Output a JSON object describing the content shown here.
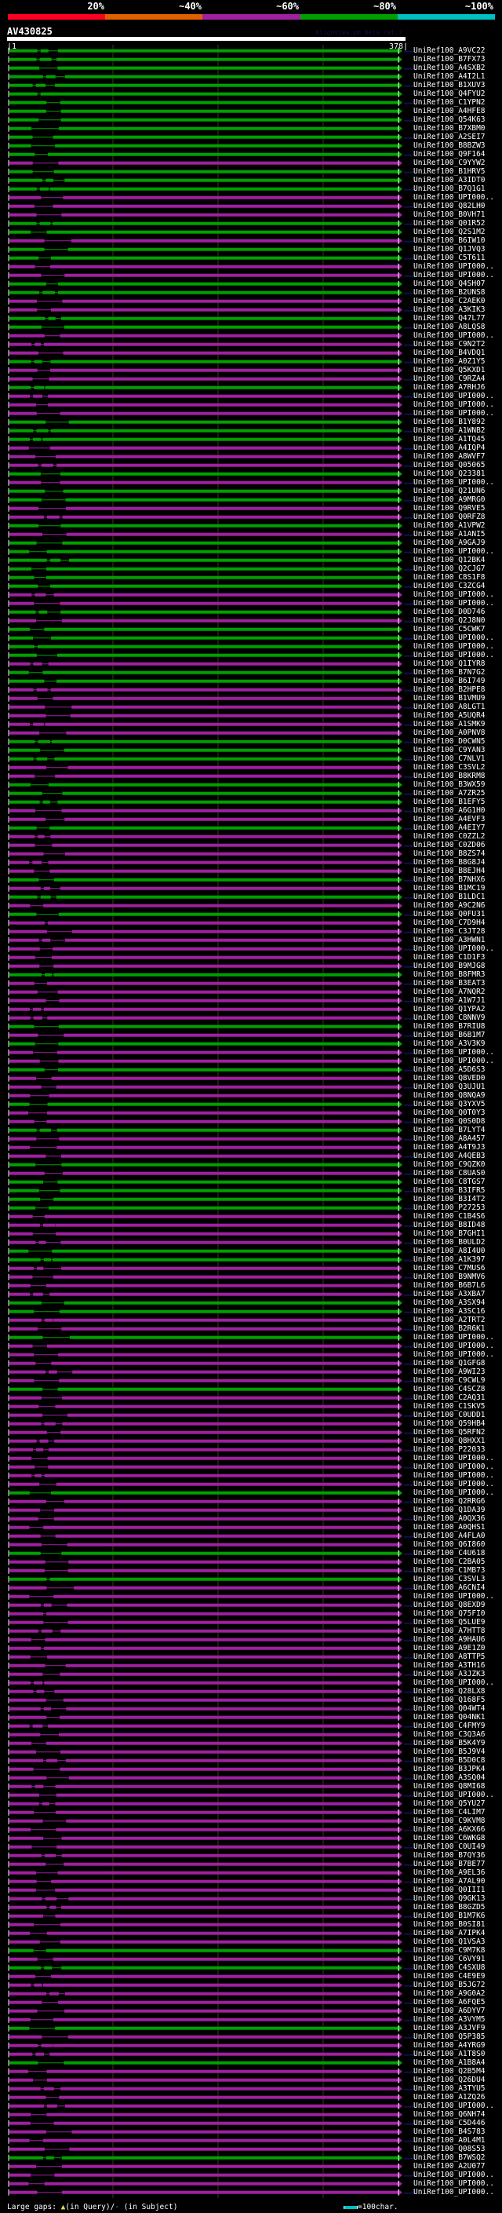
{
  "header": {
    "percent_labels": [
      "20%",
      "~40%",
      "~60%",
      "~80%",
      "~100%"
    ],
    "color_scale": [
      "#ff0020",
      "#e06000",
      "#a020a0",
      "#00a000",
      "#00c0c0"
    ],
    "query_name": "AV430825",
    "brand": "AlignView.pm Beta rel.7",
    "start": "|1",
    "end": "378|"
  },
  "colors": {
    "g": "#00a000",
    "m": "#a020a0",
    "guide": "#3a3a10",
    "connector": "#10104a"
  },
  "query_length": 378,
  "rows": [
    [
      "UniRef100_A9VC22",
      "g"
    ],
    [
      "UniRef100_B7FX73",
      "g"
    ],
    [
      "UniRef100_A4SXB2",
      "g"
    ],
    [
      "UniRef100_A4I2L1",
      "g"
    ],
    [
      "UniRef100_B1XUV3",
      "g"
    ],
    [
      "UniRef100_Q4FYU2",
      "g"
    ],
    [
      "UniRef100_C1YPN2",
      "g"
    ],
    [
      "UniRef100_A4HFE8",
      "g"
    ],
    [
      "UniRef100_Q54K63",
      "g"
    ],
    [
      "UniRef100_B7XBM0",
      "g"
    ],
    [
      "UniRef100_A2SEI7",
      "g"
    ],
    [
      "UniRef100_B8BZW3",
      "g"
    ],
    [
      "UniRef100_Q9F164",
      "g"
    ],
    [
      "UniRef100_C9YYW2",
      "m"
    ],
    [
      "UniRef100_B1HRV5",
      "g"
    ],
    [
      "UniRef100_A3IDT0",
      "g"
    ],
    [
      "UniRef100_B7Q1G1",
      "g"
    ],
    [
      "UniRef100_UPI000..",
      "m"
    ],
    [
      "UniRef100_Q82LH0",
      "m"
    ],
    [
      "UniRef100_B0VH71",
      "m"
    ],
    [
      "UniRef100_Q01R52",
      "g"
    ],
    [
      "UniRef100_Q2S1M2",
      "g"
    ],
    [
      "UniRef100_B6IW10",
      "m"
    ],
    [
      "UniRef100_Q1JVQ3",
      "g"
    ],
    [
      "UniRef100_C5T611",
      "g"
    ],
    [
      "UniRef100_UPI000..",
      "m"
    ],
    [
      "UniRef100_UPI000..",
      "m"
    ],
    [
      "UniRef100_Q4SH07",
      "g"
    ],
    [
      "UniRef100_B2UNS8",
      "g"
    ],
    [
      "UniRef100_C2AEK0",
      "m"
    ],
    [
      "UniRef100_A3KIK3",
      "m"
    ],
    [
      "UniRef100_Q47L77",
      "g"
    ],
    [
      "UniRef100_A8LQS8",
      "g"
    ],
    [
      "UniRef100_UPI000..",
      "m"
    ],
    [
      "UniRef100_C9N2T2",
      "m"
    ],
    [
      "UniRef100_B4VDQ1",
      "m"
    ],
    [
      "UniRef100_A0Z1Y5",
      "g"
    ],
    [
      "UniRef100_Q5KXD1",
      "m"
    ],
    [
      "UniRef100_C9RZA4",
      "m"
    ],
    [
      "UniRef100_A7RHJ6",
      "g"
    ],
    [
      "UniRef100_UPI000..",
      "m"
    ],
    [
      "UniRef100_UPI000..",
      "m"
    ],
    [
      "UniRef100_UPI000..",
      "m"
    ],
    [
      "UniRef100_B1Y892",
      "g"
    ],
    [
      "UniRef100_A1WNB2",
      "g"
    ],
    [
      "UniRef100_A1TQ45",
      "g"
    ],
    [
      "UniRef100_A4IQP4",
      "m"
    ],
    [
      "UniRef100_A8WVF7",
      "m"
    ],
    [
      "UniRef100_Q05065",
      "m"
    ],
    [
      "UniRef100_Q23381",
      "g"
    ],
    [
      "UniRef100_UPI000..",
      "m"
    ],
    [
      "UniRef100_Q21UN6",
      "g"
    ],
    [
      "UniRef100_A9MRG0",
      "g"
    ],
    [
      "UniRef100_Q9RVE5",
      "m"
    ],
    [
      "UniRef100_Q0RFZ8",
      "m"
    ],
    [
      "UniRef100_A1VPW2",
      "g"
    ],
    [
      "UniRef100_A1ANI5",
      "m"
    ],
    [
      "UniRef100_A9GAJ9",
      "g"
    ],
    [
      "UniRef100_UPI000..",
      "g"
    ],
    [
      "UniRef100_Q12BK4",
      "g"
    ],
    [
      "UniRef100_Q2CJG7",
      "g"
    ],
    [
      "UniRef100_C8S1F8",
      "g"
    ],
    [
      "UniRef100_C3ZCG4",
      "g"
    ],
    [
      "UniRef100_UPI000..",
      "m"
    ],
    [
      "UniRef100_UPI000..",
      "m"
    ],
    [
      "UniRef100_D0D746",
      "g"
    ],
    [
      "UniRef100_Q2J8N0",
      "m"
    ],
    [
      "UniRef100_C5CWK7",
      "g"
    ],
    [
      "UniRef100_UPI000..",
      "g"
    ],
    [
      "UniRef100_UPI000..",
      "g"
    ],
    [
      "UniRef100_UPI000..",
      "g"
    ],
    [
      "UniRef100_Q1IYR8",
      "m"
    ],
    [
      "UniRef100_B7N7G2",
      "g"
    ],
    [
      "UniRef100_B6I749",
      "g"
    ],
    [
      "UniRef100_B2HPE8",
      "m"
    ],
    [
      "UniRef100_B1VMU9",
      "m"
    ],
    [
      "UniRef100_A8LGT1",
      "m"
    ],
    [
      "UniRef100_A5UQR4",
      "m"
    ],
    [
      "UniRef100_A1SMK9",
      "m"
    ],
    [
      "UniRef100_A0PNV8",
      "m"
    ],
    [
      "UniRef100_D0CWN5",
      "g"
    ],
    [
      "UniRef100_C9YAN3",
      "g"
    ],
    [
      "UniRef100_C7NLV1",
      "g"
    ],
    [
      "UniRef100_C3SVL2",
      "m"
    ],
    [
      "UniRef100_B8KRM8",
      "m"
    ],
    [
      "UniRef100_B3WX59",
      "g"
    ],
    [
      "UniRef100_A7ZR25",
      "g"
    ],
    [
      "UniRef100_B1EFY5",
      "g"
    ],
    [
      "UniRef100_A6G1H0",
      "m"
    ],
    [
      "UniRef100_A4EVF3",
      "m"
    ],
    [
      "UniRef100_A4EIY7",
      "g"
    ],
    [
      "UniRef100_C0ZZL2",
      "m"
    ],
    [
      "UniRef100_C0ZD06",
      "m"
    ],
    [
      "UniRef100_B8ZS74",
      "m"
    ],
    [
      "UniRef100_B8G8J4",
      "m"
    ],
    [
      "UniRef100_B8EJH4",
      "m"
    ],
    [
      "UniRef100_B7NHX6",
      "g"
    ],
    [
      "UniRef100_B1MC19",
      "m"
    ],
    [
      "UniRef100_B1LDC1",
      "g"
    ],
    [
      "UniRef100_A9C2N6",
      "m"
    ],
    [
      "UniRef100_Q0FU31",
      "g"
    ],
    [
      "UniRef100_C7D9H4",
      "m"
    ],
    [
      "UniRef100_C3JT28",
      "m"
    ],
    [
      "UniRef100_A3HWN1",
      "m"
    ],
    [
      "UniRef100_UPI000..",
      "m"
    ],
    [
      "UniRef100_C1D1F3",
      "m"
    ],
    [
      "UniRef100_B9MJG8",
      "m"
    ],
    [
      "UniRef100_B8FMR3",
      "g"
    ],
    [
      "UniRef100_B3EAT3",
      "m"
    ],
    [
      "UniRef100_A7NQR2",
      "m"
    ],
    [
      "UniRef100_A1W7J1",
      "m"
    ],
    [
      "UniRef100_Q1YPA2",
      "m"
    ],
    [
      "UniRef100_C8NNV9",
      "m"
    ],
    [
      "UniRef100_B7RIU8",
      "g"
    ],
    [
      "UniRef100_B6B1M7",
      "m"
    ],
    [
      "UniRef100_A3V3K9",
      "g"
    ],
    [
      "UniRef100_UPI000..",
      "m"
    ],
    [
      "UniRef100_UPI000..",
      "m"
    ],
    [
      "UniRef100_A5D6S3",
      "g"
    ],
    [
      "UniRef100_Q8VED0",
      "m"
    ],
    [
      "UniRef100_Q3UJU1",
      "m"
    ],
    [
      "UniRef100_Q8NQA9",
      "m"
    ],
    [
      "UniRef100_Q3YXV5",
      "g"
    ],
    [
      "UniRef100_Q0T0Y3",
      "m"
    ],
    [
      "UniRef100_Q0S0D8",
      "m"
    ],
    [
      "UniRef100_B7LYT4",
      "g"
    ],
    [
      "UniRef100_A8A457",
      "m"
    ],
    [
      "UniRef100_A4T9J3",
      "m"
    ],
    [
      "UniRef100_A4QEB3",
      "m"
    ],
    [
      "UniRef100_C9QZK0",
      "g"
    ],
    [
      "UniRef100_C8UAS0",
      "m"
    ],
    [
      "UniRef100_C8TGS7",
      "g"
    ],
    [
      "UniRef100_B3IFR5",
      "g"
    ],
    [
      "UniRef100_B3I4T2",
      "g"
    ],
    [
      "UniRef100_P27253",
      "g"
    ],
    [
      "UniRef100_C1B4S6",
      "m"
    ],
    [
      "UniRef100_B8ID48",
      "m"
    ],
    [
      "UniRef100_B7GHI1",
      "m"
    ],
    [
      "UniRef100_B0ULD2",
      "m"
    ],
    [
      "UniRef100_A8I4U0",
      "g"
    ],
    [
      "UniRef100_A1K397",
      "g"
    ],
    [
      "UniRef100_C7MUS6",
      "m"
    ],
    [
      "UniRef100_B9NMV6",
      "m"
    ],
    [
      "UniRef100_B6B7L6",
      "m"
    ],
    [
      "UniRef100_A3XBA7",
      "m"
    ],
    [
      "UniRef100_A3SX94",
      "g"
    ],
    [
      "UniRef100_A3SC16",
      "g"
    ],
    [
      "UniRef100_A2TRT2",
      "m"
    ],
    [
      "UniRef100_B2R6K1",
      "m"
    ],
    [
      "UniRef100_UPI000..",
      "g"
    ],
    [
      "UniRef100_UPI000..",
      "m"
    ],
    [
      "UniRef100_UPI000..",
      "m"
    ],
    [
      "UniRef100_Q1GFG8",
      "m"
    ],
    [
      "UniRef100_A9WI23",
      "m"
    ],
    [
      "UniRef100_C9CWL9",
      "m"
    ],
    [
      "UniRef100_C4SCZ8",
      "g"
    ],
    [
      "UniRef100_C2AQ31",
      "m"
    ],
    [
      "UniRef100_C1SKV5",
      "m"
    ],
    [
      "UniRef100_C0UDD1",
      "m"
    ],
    [
      "UniRef100_Q59HB4",
      "m"
    ],
    [
      "UniRef100_Q5RFN2",
      "m"
    ],
    [
      "UniRef100_Q8HXX1",
      "m"
    ],
    [
      "UniRef100_P22033",
      "m"
    ],
    [
      "UniRef100_UPI000..",
      "m"
    ],
    [
      "UniRef100_UPI000..",
      "m"
    ],
    [
      "UniRef100_UPI000..",
      "m"
    ],
    [
      "UniRef100_UPI000..",
      "m"
    ],
    [
      "UniRef100_UPI000..",
      "g"
    ],
    [
      "UniRef100_Q2RRG6",
      "m"
    ],
    [
      "UniRef100_Q1DA39",
      "m"
    ],
    [
      "UniRef100_A0QX36",
      "m"
    ],
    [
      "UniRef100_A0QHS1",
      "m"
    ],
    [
      "UniRef100_A4FLA0",
      "m"
    ],
    [
      "UniRef100_Q6I860",
      "m"
    ],
    [
      "UniRef100_C4U618",
      "g"
    ],
    [
      "UniRef100_C2BA05",
      "m"
    ],
    [
      "UniRef100_C1MB73",
      "m"
    ],
    [
      "UniRef100_C3SVL3",
      "g"
    ],
    [
      "UniRef100_A6CNI4",
      "m"
    ],
    [
      "UniRef100_UPI000..",
      "m"
    ],
    [
      "UniRef100_Q8EXD9",
      "m"
    ],
    [
      "UniRef100_Q75FI0",
      "m"
    ],
    [
      "UniRef100_Q5LUE9",
      "m"
    ],
    [
      "UniRef100_A7HTT8",
      "m"
    ],
    [
      "UniRef100_A9HAU6",
      "m"
    ],
    [
      "UniRef100_A9E1Z0",
      "m"
    ],
    [
      "UniRef100_A8TTP5",
      "m"
    ],
    [
      "UniRef100_A3TH16",
      "m"
    ],
    [
      "UniRef100_A3JZK3",
      "m"
    ],
    [
      "UniRef100_UPI000..",
      "m"
    ],
    [
      "UniRef100_Q28LX8",
      "m"
    ],
    [
      "UniRef100_Q168F5",
      "m"
    ],
    [
      "UniRef100_Q04WT4",
      "m"
    ],
    [
      "UniRef100_Q04NK1",
      "m"
    ],
    [
      "UniRef100_C4FMY9",
      "m"
    ],
    [
      "UniRef100_C3Q3A6",
      "m"
    ],
    [
      "UniRef100_B5K4Y9",
      "m"
    ],
    [
      "UniRef100_B5J9V4",
      "m"
    ],
    [
      "UniRef100_B5D0C8",
      "m"
    ],
    [
      "UniRef100_B3JPK4",
      "m"
    ],
    [
      "UniRef100_A3SQ04",
      "m"
    ],
    [
      "UniRef100_Q8MI68",
      "m"
    ],
    [
      "UniRef100_UPI000..",
      "m"
    ],
    [
      "UniRef100_Q5YU27",
      "m"
    ],
    [
      "UniRef100_C4LIM7",
      "m"
    ],
    [
      "UniRef100_C9KVM8",
      "m"
    ],
    [
      "UniRef100_A6KX66",
      "m"
    ],
    [
      "UniRef100_C6WKG8",
      "m"
    ],
    [
      "UniRef100_C0UI49",
      "m"
    ],
    [
      "UniRef100_B7QY36",
      "m"
    ],
    [
      "UniRef100_B7BE77",
      "m"
    ],
    [
      "UniRef100_A9EL36",
      "m"
    ],
    [
      "UniRef100_A7AL90",
      "m"
    ],
    [
      "UniRef100_Q0III1",
      "m"
    ],
    [
      "UniRef100_Q9GK13",
      "m"
    ],
    [
      "UniRef100_B8GZD5",
      "m"
    ],
    [
      "UniRef100_B1M7K6",
      "m"
    ],
    [
      "UniRef100_B0SI81",
      "m"
    ],
    [
      "UniRef100_A7IPK4",
      "m"
    ],
    [
      "UniRef100_Q1VSA3",
      "m"
    ],
    [
      "UniRef100_C9M7K8",
      "g"
    ],
    [
      "UniRef100_C6VY91",
      "m"
    ],
    [
      "UniRef100_C4SXU8",
      "g"
    ],
    [
      "UniRef100_C4E9E9",
      "m"
    ],
    [
      "UniRef100_B5JG72",
      "m"
    ],
    [
      "UniRef100_A9G0A2",
      "m"
    ],
    [
      "UniRef100_A6FQE5",
      "m"
    ],
    [
      "UniRef100_A6DYV7",
      "m"
    ],
    [
      "UniRef100_A3VYM5",
      "m"
    ],
    [
      "UniRef100_A3JVF9",
      "g"
    ],
    [
      "UniRef100_Q5P385",
      "m"
    ],
    [
      "UniRef100_A4YRG9",
      "m"
    ],
    [
      "UniRef100_A1T8S0",
      "m"
    ],
    [
      "UniRef100_A1B8A4",
      "g"
    ],
    [
      "UniRef100_Q2B5M4",
      "m"
    ],
    [
      "UniRef100_Q26DU4",
      "m"
    ],
    [
      "UniRef100_A3TYU5",
      "m"
    ],
    [
      "UniRef100_A1ZQ26",
      "m"
    ],
    [
      "UniRef100_UPI000..",
      "m"
    ],
    [
      "UniRef100_Q6NH74",
      "m"
    ],
    [
      "UniRef100_C5D446",
      "m"
    ],
    [
      "UniRef100_B4S783",
      "m"
    ],
    [
      "UniRef100_A0L4M1",
      "m"
    ],
    [
      "UniRef100_Q08S53",
      "m"
    ],
    [
      "UniRef100_B7WSQ2",
      "g"
    ],
    [
      "UniRef100_A2U077",
      "m"
    ],
    [
      "UniRef100_UPI000..",
      "m"
    ],
    [
      "UniRef100_UPI000..",
      "m"
    ],
    [
      "UniRef100_UPI000..",
      "m"
    ]
  ],
  "footer": {
    "large_gaps_label": "Large gaps:",
    "query_gap_icon": "yellow-marker",
    "in_query": "(in Query)/",
    "subject_gap_symbol": "-",
    "in_subject": "(in Subject)",
    "scale_label": "=100char."
  }
}
